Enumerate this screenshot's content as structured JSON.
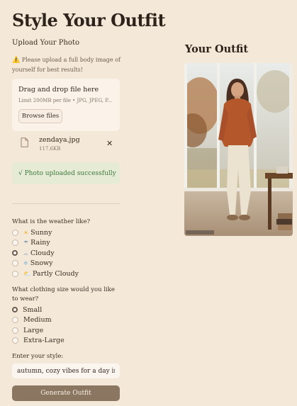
{
  "page": {
    "title": "Style Your Outfit"
  },
  "upload": {
    "label": "Upload Your Photo",
    "hint_icon": "⚠️",
    "hint": "Please upload a full body image of yourself for best results!",
    "dropzone_title": "Drag and drop file here",
    "dropzone_sub": "Limit 200MB per file • JPG, JPEG, P...",
    "browse_label": "Browse files",
    "file_name": "zendaya.jpg",
    "file_size": "117.6KB",
    "success": "√ Photo uploaded successfully"
  },
  "weather": {
    "question": "What is the weather like?",
    "selected": "Cloudy",
    "options": [
      {
        "label": "Sunny",
        "emoji": "☀",
        "icon": "sun-icon",
        "color": "#f2b632"
      },
      {
        "label": "Rainy",
        "emoji": "☂",
        "icon": "rain-cloud-icon",
        "color": "#8ea3b5"
      },
      {
        "label": "Cloudy",
        "emoji": "☁",
        "icon": "cloud-icon",
        "color": "#c9cdd2"
      },
      {
        "label": "Snowy",
        "emoji": "❄",
        "icon": "snowflake-icon",
        "color": "#8fb8d9"
      },
      {
        "label": "Partly Cloudy",
        "emoji": "⛅",
        "icon": "partly-cloudy-icon",
        "color": "#e8b84a"
      }
    ]
  },
  "size": {
    "question": "What clothing size would you like to wear?",
    "selected": "Small",
    "options": [
      "Small",
      "Medium",
      "Large",
      "Extra-Large"
    ]
  },
  "style": {
    "label": "Enter your style:",
    "value": "autumn, cozy vibes for a day in"
  },
  "generate_label": "Generate Outfit",
  "result": {
    "heading": "Your Outfit"
  },
  "colors": {
    "background": "#f4e8d8",
    "button": "#8b7661",
    "success_bg": "#e6ebd6",
    "success_text": "#3f7a3a"
  }
}
